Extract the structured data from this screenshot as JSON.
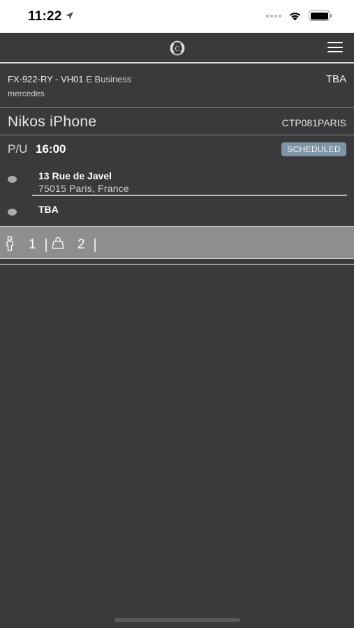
{
  "status_bar": {
    "time": "11:22"
  },
  "vehicle": {
    "plate_code": "FX-922-RY - VH01",
    "class": "E Business",
    "make": "mercedes",
    "status": "TBA"
  },
  "passenger": {
    "name": "Nikos iPhone",
    "booking_ref": "CTP081PARIS"
  },
  "pickup": {
    "label": "P/U",
    "time": "16:00",
    "status": "SCHEDULED",
    "status_color": "#7d95a6"
  },
  "stops": [
    {
      "title": "13 Rue de Javel",
      "subtitle": "75015 Paris, France"
    },
    {
      "title": "TBA",
      "subtitle": ""
    }
  ],
  "luggage": {
    "passengers": "1",
    "bags": "2"
  },
  "icons": [
    "location-arrow-icon",
    "signal-dots-icon",
    "wifi-icon",
    "battery-icon",
    "logo-icon",
    "menu-icon",
    "passenger-icon",
    "bag-icon"
  ],
  "colors": {
    "background": "#3a393b",
    "luggage_bar": "#8e8e8e"
  }
}
